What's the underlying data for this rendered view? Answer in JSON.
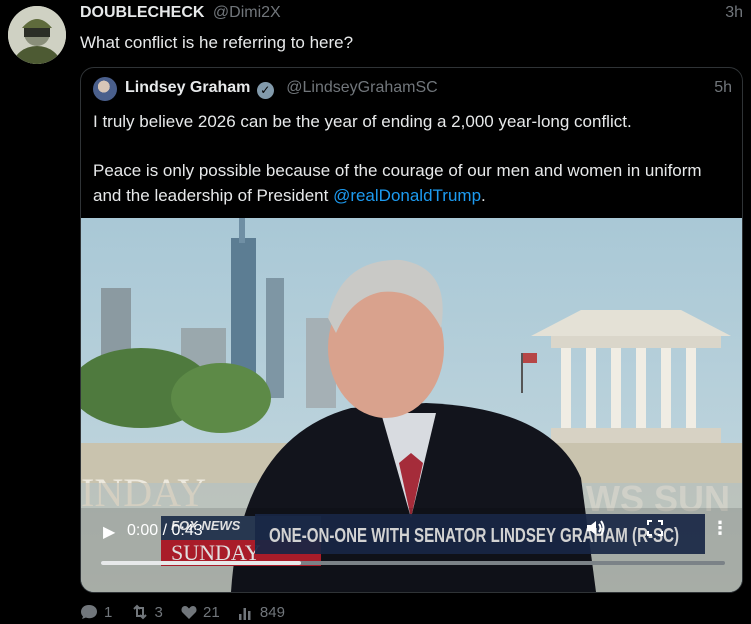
{
  "post": {
    "author_name": "DOUBLECHECK",
    "author_handle": "@Dimi2X",
    "time": "3h",
    "text": "What conflict is he referring to here?"
  },
  "quoted": {
    "author_name": "Lindsey Graham",
    "author_handle": "@LindseyGrahamSC",
    "time": "5h",
    "paragraph1": "I truly believe 2026 can be the year of ending a 2,000 year-long conflict.",
    "paragraph2_prefix": "Peace is only possible because of the courage of our men and women in uniform and the leadership of President ",
    "mention": "@realDonaldTrump",
    "paragraph2_suffix": "."
  },
  "video": {
    "time_display": "0:00 / 0:43",
    "progress": 0.32,
    "chyron": "ONE-ON-ONE WITH SENATOR LINDSEY GRAHAM (R-SC)",
    "logo_top": "FOX NEWS",
    "logo_bottom": "SUNDAY",
    "background_text": "INDAY",
    "background_text_right": "WS SUN"
  },
  "actions": {
    "replies": "1",
    "reposts": "3",
    "likes": "21",
    "views": "849"
  },
  "icons": [
    "avatar",
    "verified-badge-icon",
    "play-icon",
    "volume-icon",
    "fullscreen-icon",
    "more-icon",
    "reply-icon",
    "repost-icon",
    "like-icon",
    "views-icon"
  ],
  "colors": {
    "background": "#000000",
    "text": "#e7e9ea",
    "muted": "#71767b",
    "link": "#1d9bf0",
    "border": "#2f3336"
  }
}
